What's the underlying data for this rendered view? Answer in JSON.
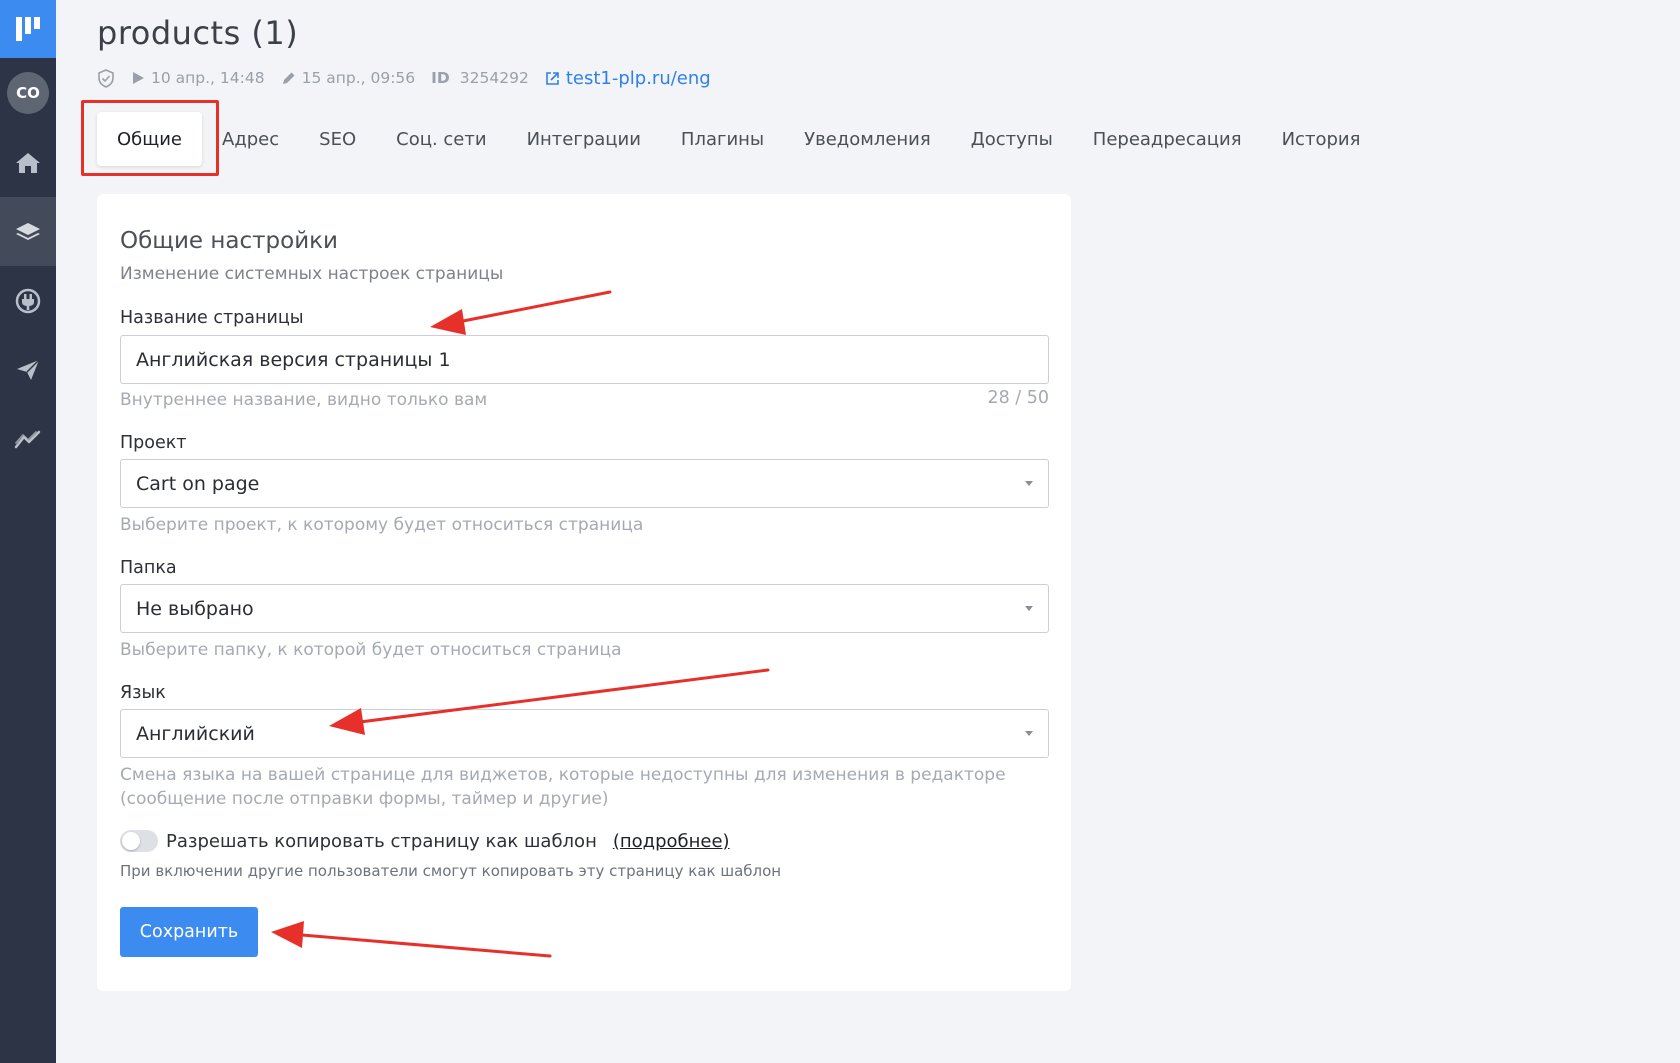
{
  "sidebar": {
    "avatar_initials": "CO",
    "items": [
      {
        "icon": "home-icon"
      },
      {
        "icon": "layers-icon",
        "active": true
      },
      {
        "icon": "plug-icon"
      },
      {
        "icon": "send-icon"
      },
      {
        "icon": "analytics-icon"
      }
    ]
  },
  "header": {
    "title": "products (1)",
    "published": "10 апр., 14:48",
    "edited": "15 апр., 09:56",
    "id_label": "ID",
    "id_value": "3254292",
    "link": "test1-plp.ru/eng"
  },
  "tabs": [
    {
      "label": "Общие",
      "active": true
    },
    {
      "label": "Адрес"
    },
    {
      "label": "SEO"
    },
    {
      "label": "Соц. сети"
    },
    {
      "label": "Интеграции"
    },
    {
      "label": "Плагины"
    },
    {
      "label": "Уведомления"
    },
    {
      "label": "Доступы"
    },
    {
      "label": "Переадресация"
    },
    {
      "label": "История"
    }
  ],
  "form": {
    "title": "Общие настройки",
    "subtitle": "Изменение системных настроек страницы",
    "name_label": "Название страницы",
    "name_value": "Английская версия страницы 1",
    "name_hint": "Внутреннее название, видно только вам",
    "name_counter": "28 / 50",
    "project_label": "Проект",
    "project_value": "Cart on page",
    "project_hint": "Выберите проект, к которому будет относиться страница",
    "folder_label": "Папка",
    "folder_value": "Не выбрано",
    "folder_hint": "Выберите папку, к которой будет относиться страница",
    "lang_label": "Язык",
    "lang_value": "Английский",
    "lang_hint_1": "Смена языка на вашей странице для виджетов, которые недоступны для изменения в редакторе",
    "lang_hint_2": "(сообщение после отправки формы, таймер и другие)",
    "copy_toggle_label": "Разрешать копировать страницу как шаблон",
    "copy_more_link": "(подробнее)",
    "copy_toggle_on": false,
    "copy_hint": "При включении другие пользователи смогут копировать эту страницу как шаблон",
    "save_label": "Сохранить"
  },
  "colors": {
    "accent": "#3b8bf0",
    "sidebar": "#2d3445",
    "annotation": "#e8302a"
  }
}
